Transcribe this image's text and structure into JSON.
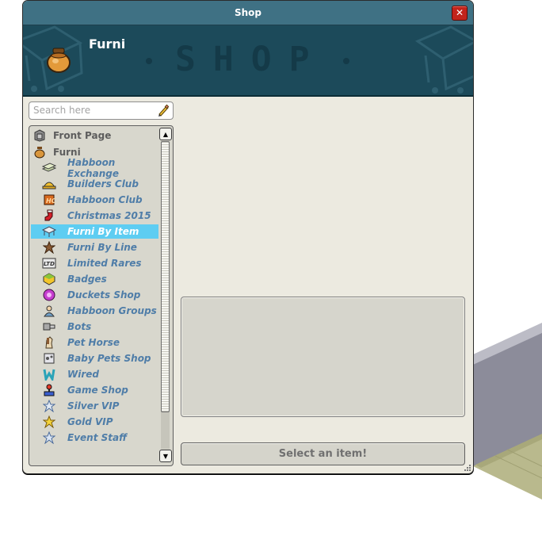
{
  "window": {
    "title": "Shop",
    "close_label": "✕"
  },
  "banner": {
    "title": "Furni",
    "logo_text": "SHOP",
    "icon": "furni-bag-icon"
  },
  "search": {
    "placeholder": "Search here",
    "value": ""
  },
  "catalog": {
    "items": [
      {
        "label": "Front Page",
        "level": "top",
        "icon": "front-page-icon"
      },
      {
        "label": "Furni",
        "level": "top",
        "icon": "furni-bag-icon"
      },
      {
        "label": "Habboon Exchange",
        "level": "sub",
        "icon": "exchange-icon"
      },
      {
        "label": "Builders Club",
        "level": "sub",
        "icon": "builders-helmet-icon"
      },
      {
        "label": "Habboon Club",
        "level": "sub",
        "icon": "club-icon"
      },
      {
        "label": "Christmas 2015",
        "level": "sub",
        "icon": "stocking-icon"
      },
      {
        "label": "Furni By Item",
        "level": "sub",
        "icon": "furni-item-icon",
        "selected": true
      },
      {
        "label": "Furni By Line",
        "level": "sub",
        "icon": "line-star-icon"
      },
      {
        "label": "Limited Rares",
        "level": "sub",
        "icon": "ltd-icon"
      },
      {
        "label": "Badges",
        "level": "sub",
        "icon": "badge-icon"
      },
      {
        "label": "Duckets Shop",
        "level": "sub",
        "icon": "duckets-icon"
      },
      {
        "label": "Habboon Groups",
        "level": "sub",
        "icon": "groups-icon"
      },
      {
        "label": "Bots",
        "level": "sub",
        "icon": "bot-icon"
      },
      {
        "label": "Pet Horse",
        "level": "sub",
        "icon": "horse-icon"
      },
      {
        "label": "Baby Pets Shop",
        "level": "sub",
        "icon": "baby-pets-icon"
      },
      {
        "label": "Wired",
        "level": "sub",
        "icon": "wired-icon"
      },
      {
        "label": "Game Shop",
        "level": "sub",
        "icon": "joystick-icon"
      },
      {
        "label": "Silver VIP",
        "level": "sub",
        "icon": "silver-star-icon"
      },
      {
        "label": "Gold VIP",
        "level": "sub",
        "icon": "gold-star-icon"
      },
      {
        "label": "Event Staff",
        "level": "sub",
        "icon": "event-star-icon"
      }
    ]
  },
  "footer": {
    "select_label": "Select an item!"
  },
  "colors": {
    "titlebar": "#3f7184",
    "banner": "#1c4a5a",
    "selected_row": "#5ecdf2",
    "sub_item_text": "#4f7da8",
    "close_button": "#c2241b"
  }
}
